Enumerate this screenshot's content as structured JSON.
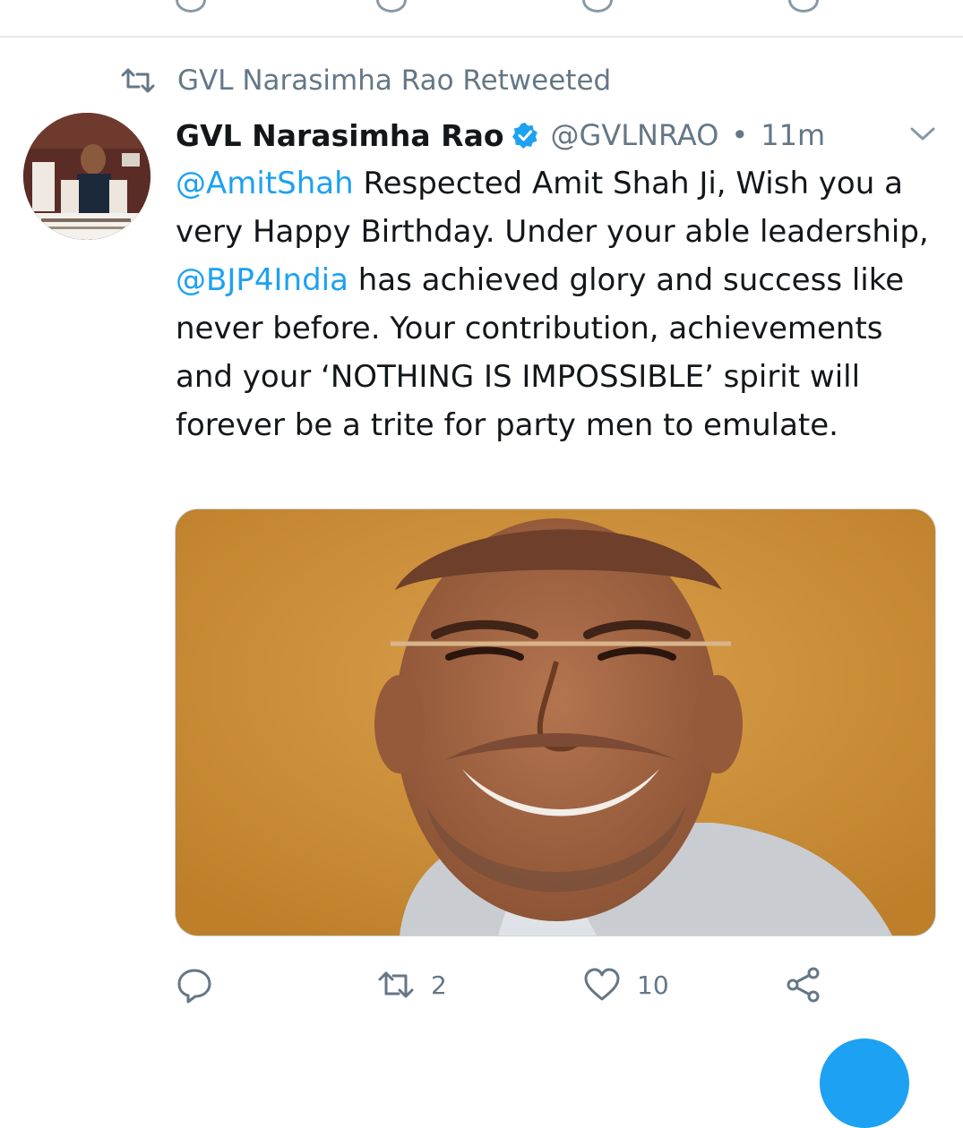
{
  "retweet_label": "GVL Narasimha Rao Retweeted",
  "tweet": {
    "display_name": "GVL Narasimha Rao",
    "handle": "@GVLNRAO",
    "separator": "•",
    "time": "11m",
    "mention_1": "@AmitShah",
    "text_1": " Respected Amit Shah Ji, Wish you a very Happy Birthday. Under your able leadership, ",
    "mention_2": "@BJP4India",
    "text_2": " has achieved glory and success like never before. Your contribution, achievements and your ‘NOTHING IS IMPOSSIBLE’ spirit will forever be a trite for party men to emulate."
  },
  "actions": {
    "reply_icon": "reply-icon",
    "retweet_icon": "retweet-icon",
    "retweet_count": "2",
    "like_icon": "heart-icon",
    "like_count": "10",
    "share_icon": "share-icon"
  },
  "colors": {
    "link": "#1da1f2",
    "muted": "#657786",
    "verified": "#1da1f2",
    "photo_background": "#cf953d"
  }
}
